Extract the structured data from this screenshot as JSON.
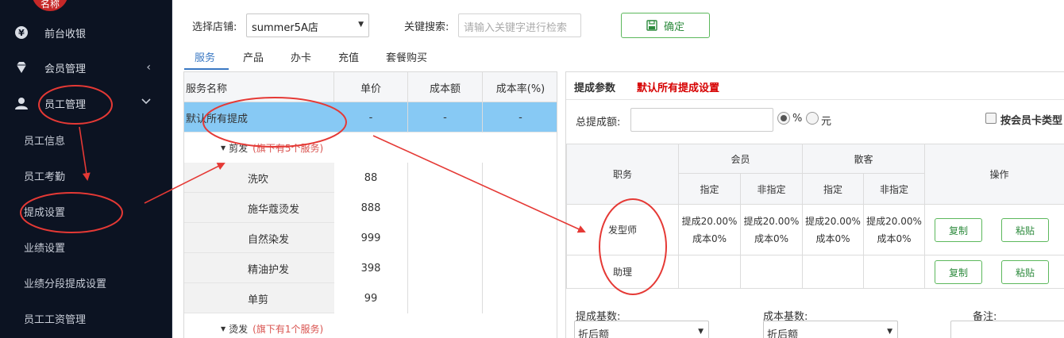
{
  "sidebar": {
    "brand_text": "名称",
    "items": [
      {
        "label": "前台收银",
        "icon": "yen-icon"
      },
      {
        "label": "会员管理",
        "icon": "diamond-icon",
        "arrow": "‹"
      },
      {
        "label": "员工管理",
        "icon": "user-icon",
        "arrow": "⌄"
      }
    ],
    "sub_items": [
      "员工信息",
      "员工考勤",
      "提成设置",
      "业绩设置",
      "业绩分段提成设置",
      "员工工资管理"
    ]
  },
  "filter": {
    "store_label": "选择店铺:",
    "store_value": "summer5A店",
    "keyword_label": "关键搜索:",
    "keyword_placeholder": "请输入关键字进行检索",
    "confirm_label": "确定"
  },
  "tabs": [
    "服务",
    "产品",
    "办卡",
    "充值",
    "套餐购买"
  ],
  "service_table": {
    "headers": [
      "服务名称",
      "单价",
      "成本额",
      "成本率(%)"
    ],
    "default_row": {
      "name": "默认所有提成",
      "price": "-",
      "cost": "-",
      "rate": "-"
    },
    "groups": [
      {
        "name": "剪发",
        "note": "(旗下有5个服务)",
        "items": [
          {
            "name": "洗吹",
            "price": "88"
          },
          {
            "name": "施华蔻烫发",
            "price": "888"
          },
          {
            "name": "自然染发",
            "price": "999"
          },
          {
            "name": "精油护发",
            "price": "398"
          },
          {
            "name": "单剪",
            "price": "99"
          }
        ]
      },
      {
        "name": "烫发",
        "note": "(旗下有1个服务)",
        "items": []
      }
    ]
  },
  "commission": {
    "title": "提成参数",
    "title_note": "默认所有提成设置",
    "total_label": "总提成额:",
    "unit_percent": "%",
    "unit_yuan": "元",
    "by_card_label": "按会员卡类型",
    "headers": {
      "position": "职务",
      "member": "会员",
      "guest": "散客",
      "assigned": "指定",
      "unassigned": "非指定",
      "action": "操作"
    },
    "rows": [
      {
        "position": "发型师",
        "values": [
          {
            "commission": "提成20.00%",
            "cost": "成本0%"
          },
          {
            "commission": "提成20.00%",
            "cost": "成本0%"
          },
          {
            "commission": "提成20.00%",
            "cost": "成本0%"
          },
          {
            "commission": "提成20.00%",
            "cost": "成本0%"
          }
        ]
      },
      {
        "position": "助理",
        "values": [
          {
            "commission": "",
            "cost": ""
          },
          {
            "commission": "",
            "cost": ""
          },
          {
            "commission": "",
            "cost": ""
          },
          {
            "commission": "",
            "cost": ""
          }
        ]
      }
    ],
    "copy_label": "复制",
    "paste_label": "粘贴",
    "base_label": "提成基数:",
    "base_value": "折后额",
    "cost_base_label": "成本基数:",
    "cost_base_value": "折后额",
    "note_label": "备注:"
  },
  "annotation_color": "#e53935",
  "accent_color": "#3a78c3",
  "button_color": "#5cb85c",
  "selected_row_color": "#87c9f4"
}
